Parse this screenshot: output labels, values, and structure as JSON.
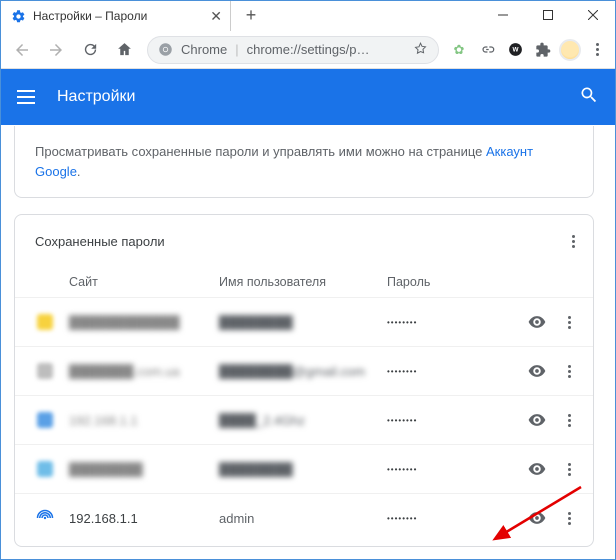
{
  "tab": {
    "title": "Настройки – Пароли"
  },
  "address": {
    "prefix": "Chrome",
    "path": "chrome://settings/p…"
  },
  "app_header": {
    "title": "Настройки"
  },
  "notice": {
    "text": "Просматривать сохраненные пароли и управлять ими можно на странице ",
    "link": "Аккаунт Google",
    "suffix": "."
  },
  "saved": {
    "heading": "Сохраненные пароли",
    "columns": {
      "site": "Сайт",
      "user": "Имя пользователя",
      "pass": "Пароль"
    },
    "rows": [
      {
        "site": "████████████",
        "user": "████████",
        "pass": "••••••••",
        "blur": true,
        "fav_color": "#f7d23e"
      },
      {
        "site": "███████.com.ua",
        "user": "████████@gmail.com",
        "pass": "••••••••",
        "blur": true,
        "fav_color": "#bdbdbd"
      },
      {
        "site": "192.168.1.1",
        "user": "████_2.4Ghz",
        "pass": "••••••••",
        "blur": true,
        "fav_color": "#5aa0e6"
      },
      {
        "site": "████████",
        "user": "████████",
        "pass": "••••••••",
        "blur": true,
        "fav_color": "#6fbde8"
      },
      {
        "site": "192.168.1.1",
        "user": "admin",
        "pass": "••••••••",
        "blur": false,
        "fav_color": "#1a73e8"
      }
    ]
  }
}
